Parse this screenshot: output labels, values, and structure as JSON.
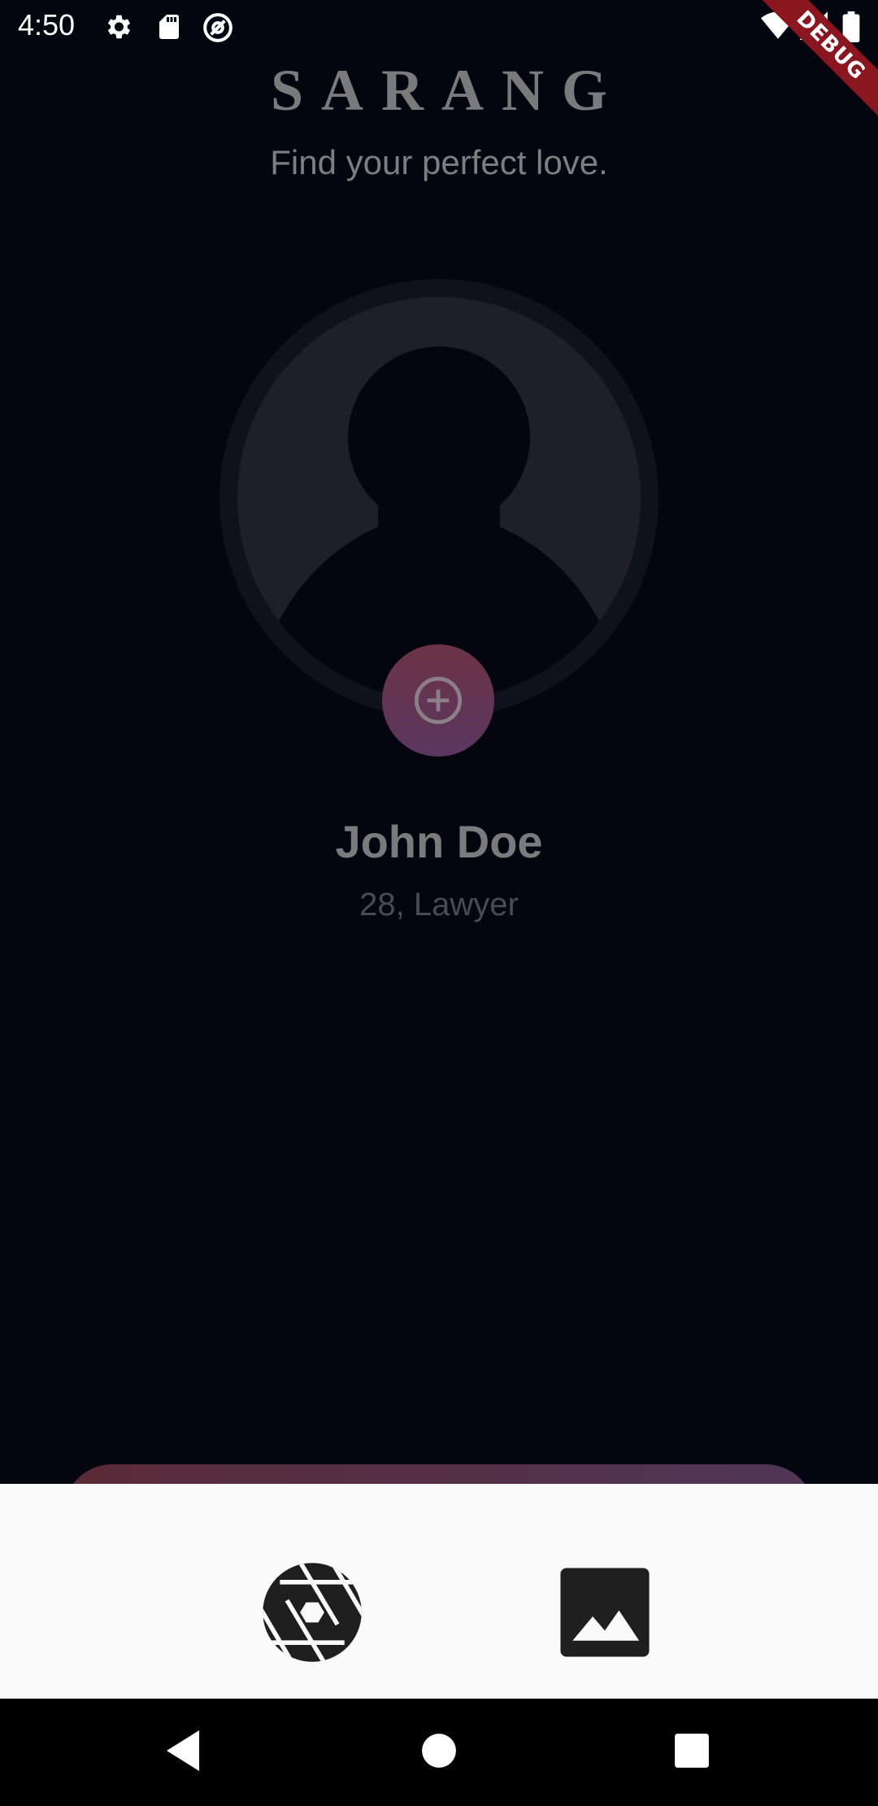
{
  "status_bar": {
    "time": "4:50",
    "left_icons": [
      "gear-icon",
      "sd-card-icon",
      "at-sign-icon"
    ],
    "right_icons": [
      "wifi-icon",
      "cell-signal-icon",
      "battery-icon"
    ]
  },
  "debug_banner": {
    "label": "DEBUG",
    "color": "#8a1620"
  },
  "header": {
    "title": "SARANG",
    "tagline": "Find your perfect love."
  },
  "profile": {
    "avatar_icon": "person-silhouette-icon",
    "add_photo_icon": "add-circle-icon",
    "name": "John Doe",
    "meta": "28, Lawyer"
  },
  "bottom_sheet": {
    "options": [
      {
        "id": "camera",
        "icon": "camera-shutter-icon"
      },
      {
        "id": "gallery",
        "icon": "image-icon"
      }
    ]
  },
  "nav_bar": {
    "buttons": [
      "back-icon",
      "home-icon",
      "recents-icon"
    ]
  },
  "colors": {
    "background": "#04050f",
    "accent_gradient_start": "#6c3345",
    "accent_gradient_end": "#5a3660",
    "sheet_background": "#fafafa"
  }
}
